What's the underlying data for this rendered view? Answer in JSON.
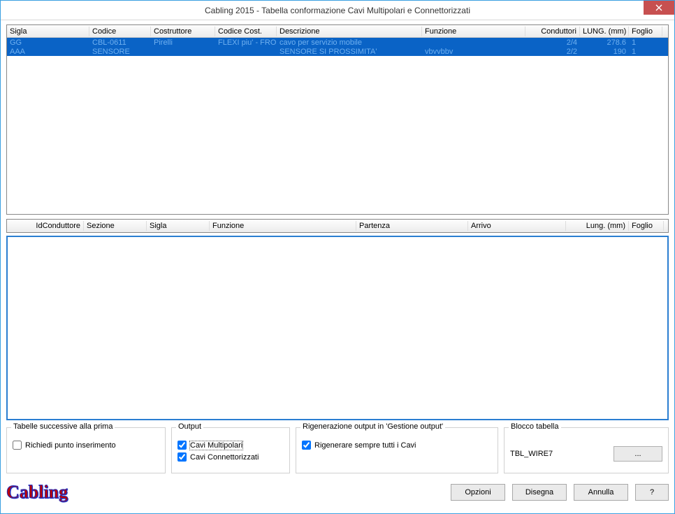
{
  "window": {
    "title": "Cabling 2015 - Tabella conformazione Cavi Multipolari e Connettorizzati"
  },
  "topGrid": {
    "columns": [
      "Sigla",
      "Codice",
      "Costruttore",
      "Codice Cost.",
      "Descrizione",
      "Funzione",
      "Conduttori",
      "LUNG. (mm)",
      "Foglio"
    ],
    "rows": [
      {
        "sigla": "GG",
        "codice": "CBL-0611",
        "costruttore": "Pirelli",
        "codcost": "FLEXI piu' - FRO",
        "descr": "cavo per servizio mobile",
        "funzione": "",
        "conduttori": "2/4",
        "lung": "278.6",
        "foglio": "1"
      },
      {
        "sigla": "AAA",
        "codice": "SENSORE",
        "costruttore": "",
        "codcost": "",
        "descr": "SENSORE SI PROSSIMITA'",
        "funzione": "vbvvbbv",
        "conduttori": "2/2",
        "lung": "190",
        "foglio": "1"
      }
    ]
  },
  "bottomGrid": {
    "columns": [
      "IdConduttore",
      "Sezione",
      "Sigla",
      "Funzione",
      "Partenza",
      "Arrivo",
      "Lung. (mm)",
      "Foglio"
    ]
  },
  "groups": {
    "successive": {
      "title": "Tabelle successive alla prima",
      "richiedi": "Richiedi punto inserimento"
    },
    "output": {
      "title": "Output",
      "multipolari": "Cavi Multipolari",
      "connettorizzati": "Cavi Connettorizzati"
    },
    "rigenerazione": {
      "title": "Rigenerazione output in 'Gestione output'",
      "sempre": "Rigenerare sempre tutti i Cavi"
    },
    "blocco": {
      "title": "Blocco tabella",
      "value": "TBL_WIRE7",
      "browse": "..."
    }
  },
  "logo": "Cabling",
  "buttons": {
    "opzioni": "Opzioni",
    "disegna": "Disegna",
    "annulla": "Annulla",
    "help": "?"
  }
}
